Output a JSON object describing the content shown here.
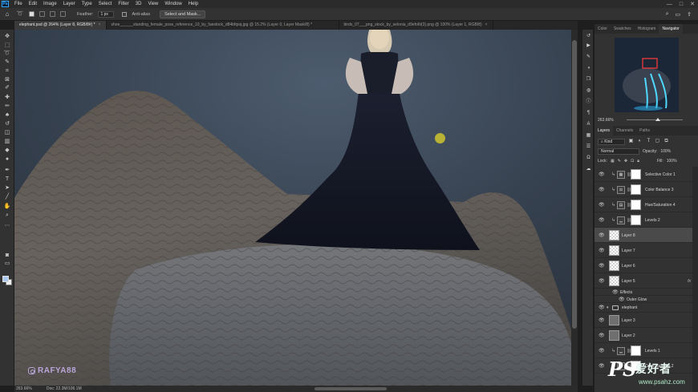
{
  "app": {
    "logo": "Ps",
    "menu": [
      "File",
      "Edit",
      "Image",
      "Layer",
      "Type",
      "Select",
      "Filter",
      "3D",
      "View",
      "Window",
      "Help"
    ],
    "window_controls": [
      "—",
      "□",
      "✕"
    ]
  },
  "options_bar": {
    "feather_label": "Feather:",
    "feather_value": "1 px",
    "antialias_label": "Anti-alias",
    "select_mask_label": "Select and Mask..."
  },
  "tabs": [
    {
      "label": "elephant.psd @ 264% (Layer 8, RGB/8#) *",
      "active": true
    },
    {
      "label": "shoe______standing_female_pose_reference_10_by_faestock_d84bfqsq.jpg @ 15.2% (Layer 0, Layer Mask/8) *",
      "active": false
    },
    {
      "label": "birds_07___png_stock_by_selonia_d9efo6t(3).png @ 100% (Layer 1, RGB/8)",
      "active": false
    }
  ],
  "toolbar": {
    "tools": [
      {
        "name": "move-tool-icon",
        "glyph": "✥"
      },
      {
        "name": "marquee-tool-icon",
        "glyph": "⬚"
      },
      {
        "name": "lasso-tool-icon",
        "glyph": "➰"
      },
      {
        "name": "quick-select-tool-icon",
        "glyph": "✎"
      },
      {
        "name": "crop-tool-icon",
        "glyph": "⌗"
      },
      {
        "name": "frame-tool-icon",
        "glyph": "⊠"
      },
      {
        "name": "eyedropper-tool-icon",
        "glyph": "✐"
      },
      {
        "name": "healing-brush-tool-icon",
        "glyph": "✚"
      },
      {
        "name": "brush-tool-icon",
        "glyph": "✏"
      },
      {
        "name": "clone-stamp-tool-icon",
        "glyph": "♣"
      },
      {
        "name": "history-brush-tool-icon",
        "glyph": "↺"
      },
      {
        "name": "eraser-tool-icon",
        "glyph": "◫"
      },
      {
        "name": "gradient-tool-icon",
        "glyph": "▥"
      },
      {
        "name": "blur-tool-icon",
        "glyph": "◆"
      },
      {
        "name": "dodge-tool-icon",
        "glyph": "●"
      },
      {
        "name": "pen-tool-icon",
        "glyph": "✒"
      },
      {
        "name": "type-tool-icon",
        "glyph": "T"
      },
      {
        "name": "path-select-tool-icon",
        "glyph": "➤"
      },
      {
        "name": "shape-tool-icon",
        "glyph": "╱"
      },
      {
        "name": "hand-tool-icon",
        "glyph": "✋"
      },
      {
        "name": "zoom-tool-icon",
        "glyph": "⌕"
      },
      {
        "name": "more-tools-icon",
        "glyph": "⋯"
      },
      {
        "name": "quick-mask-icon",
        "glyph": "◙"
      },
      {
        "name": "screen-mode-icon",
        "glyph": "▭"
      }
    ]
  },
  "canvas": {
    "watermark": "RAFYA88"
  },
  "status": {
    "zoom": "263.66%",
    "doc": "Doc: 22.3M/106.1M"
  },
  "right_strip": {
    "icons": [
      "history-icon",
      "play-icon",
      "brush-settings-icon",
      "adjustments-icon",
      "3d-icon",
      "color-wheel-icon",
      "info-icon",
      "paragraph-icon",
      "character-icon",
      "swatches-icon",
      "properties-icon",
      "glyphs-icon",
      "libraries-icon"
    ]
  },
  "navigator_panel": {
    "tabs": [
      {
        "label": "Color",
        "active": false
      },
      {
        "label": "Swatches",
        "active": false
      },
      {
        "label": "Histogram",
        "active": false
      },
      {
        "label": "Navigator",
        "active": true
      }
    ],
    "zoom": "263.66%"
  },
  "layers_panel": {
    "tabs": [
      {
        "label": "Layers",
        "active": true
      },
      {
        "label": "Channels",
        "active": false
      },
      {
        "label": "Paths",
        "active": false
      }
    ],
    "kind_label": "Kind",
    "blend_mode": "Normal",
    "opacity_label": "Opacity:",
    "opacity_value": "100%",
    "lock_label": "Lock:",
    "fill_label": "Fill:",
    "fill_value": "100%",
    "layers": [
      {
        "name": "Selective Color 1",
        "type": "adjustment",
        "glyph": "▦"
      },
      {
        "name": "Color Balance 3",
        "type": "adjustment",
        "glyph": "⚖"
      },
      {
        "name": "Hue/Saturation 4",
        "type": "adjustment",
        "glyph": "▤"
      },
      {
        "name": "Levels 2",
        "type": "adjustment",
        "glyph": "▁"
      },
      {
        "name": "Layer 8",
        "type": "pixel",
        "selected": true
      },
      {
        "name": "Layer 7",
        "type": "pixel"
      },
      {
        "name": "Layer 6",
        "type": "pixel"
      },
      {
        "name": "Layer 5",
        "type": "pixel",
        "fx": "fx"
      },
      {
        "name": "Effects",
        "type": "sub"
      },
      {
        "name": "Outer Glow",
        "type": "sub2"
      },
      {
        "name": "elephant",
        "type": "group"
      },
      {
        "name": "Layer 3",
        "type": "image"
      },
      {
        "name": "Layer 2",
        "type": "image"
      },
      {
        "name": "Levels 1",
        "type": "adjustment",
        "glyph": "▁"
      },
      {
        "name": "Color Balance 2",
        "type": "adjustment",
        "glyph": "⚖"
      }
    ]
  },
  "site_watermark": {
    "logo": "PS",
    "name": "爱好者",
    "url": "www.psahz.com"
  }
}
